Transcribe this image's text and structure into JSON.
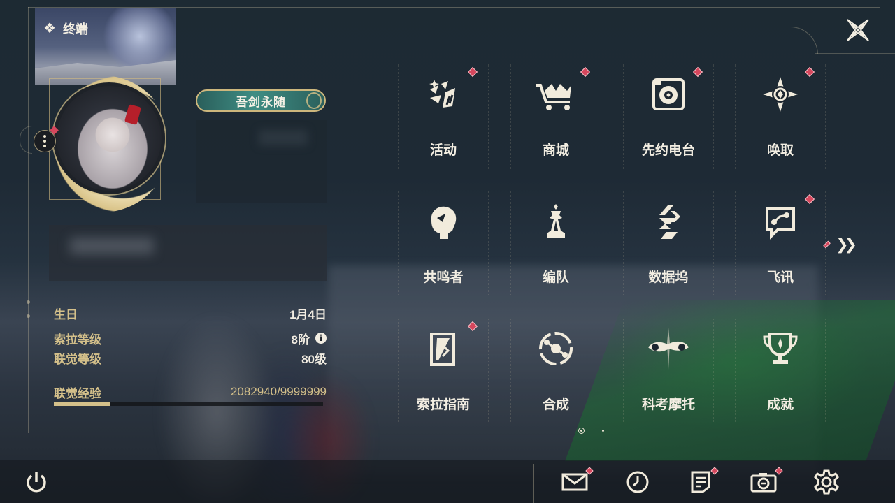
{
  "header": {
    "title": "终端"
  },
  "profile": {
    "title_badge": "吾剑永随",
    "stats": [
      {
        "label": "生日",
        "value": "1月4日"
      },
      {
        "label": "索拉等级",
        "value": "8阶"
      },
      {
        "label": "联觉等级",
        "value": "80级"
      },
      {
        "label": "联觉经验",
        "value": "2082940/9999999"
      }
    ],
    "exp_fraction": 0.208
  },
  "menu": {
    "items": [
      {
        "label": "活动",
        "icon": "activity-icon",
        "notify": true
      },
      {
        "label": "商城",
        "icon": "shop-cart-icon",
        "notify": true
      },
      {
        "label": "先约电台",
        "icon": "radio-icon",
        "notify": true
      },
      {
        "label": "唤取",
        "icon": "summon-compass-icon",
        "notify": true
      },
      {
        "label": "共鸣者",
        "icon": "resonator-icon",
        "notify": false
      },
      {
        "label": "编队",
        "icon": "team-chess-icon",
        "notify": false
      },
      {
        "label": "数据坞",
        "icon": "data-dock-icon",
        "notify": false
      },
      {
        "label": "飞讯",
        "icon": "message-icon",
        "notify": true
      },
      {
        "label": "索拉指南",
        "icon": "guidebook-icon",
        "notify": true
      },
      {
        "label": "合成",
        "icon": "synthesis-icon",
        "notify": false
      },
      {
        "label": "科考摩托",
        "icon": "motorcycle-icon",
        "notify": false
      },
      {
        "label": "成就",
        "icon": "trophy-icon",
        "notify": false
      }
    ],
    "page": 1,
    "pages": 2
  },
  "bottom_bar": {
    "icons": [
      "power-icon",
      "mail-icon",
      "clock-icon",
      "notes-icon",
      "camera-icon",
      "settings-gear-icon"
    ]
  },
  "colors": {
    "accent_gold": "#d4c08a",
    "notify_red": "#d6475d",
    "badge_teal": "#3f8d84"
  }
}
